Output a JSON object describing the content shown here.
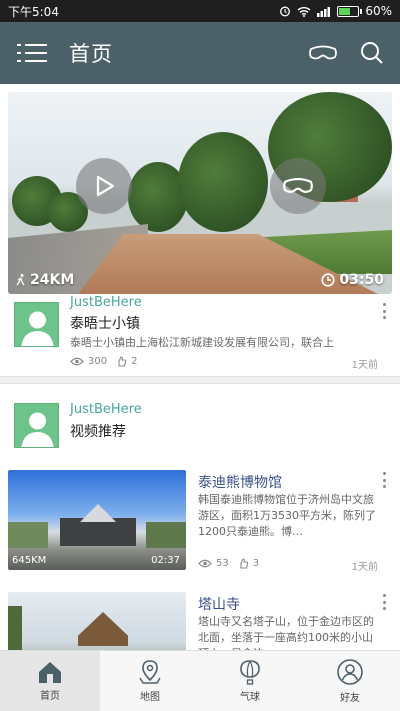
{
  "status": {
    "time": "下午5:04",
    "battery": "60%",
    "battery_level": 0.6
  },
  "appbar": {
    "title": "首页",
    "menu_icon": "menu-icon",
    "vr_icon": "vr-glasses-icon",
    "search_icon": "search-icon"
  },
  "hero": {
    "distance": "24KM",
    "duration": "03:50"
  },
  "post1": {
    "username": "JustBeHere",
    "title": "泰晤士小镇",
    "description": "泰晤士小镇由上海松江新城建设发展有限公司，联合上",
    "views": "300",
    "likes": "2",
    "time": "1天前"
  },
  "post2": {
    "username": "JustBeHere",
    "title": "视频推荐"
  },
  "items": [
    {
      "title": "泰迪熊博物馆",
      "description": "韩国泰迪熊博物馆位于济州岛中文旅游区，面积1万3530平方米，陈列了1200只泰迪熊。博…",
      "distance": "645KM",
      "duration": "02:37",
      "views": "53",
      "likes": "3",
      "time": "1天前"
    },
    {
      "title": "塔山寺",
      "description": "塔山寺又名塔子山，位于金边市区的北面，坐落于一座高约100米的小山顶上，是金边"
    }
  ],
  "tabs": [
    {
      "label": "首页",
      "icon": "home-icon"
    },
    {
      "label": "地图",
      "icon": "map-pin-icon"
    },
    {
      "label": "气球",
      "icon": "balloon-icon"
    },
    {
      "label": "好友",
      "icon": "friends-icon"
    }
  ],
  "colors": {
    "appbar": "#4c6069",
    "username": "#4aa6a0",
    "item_title": "#3a4f8a"
  }
}
